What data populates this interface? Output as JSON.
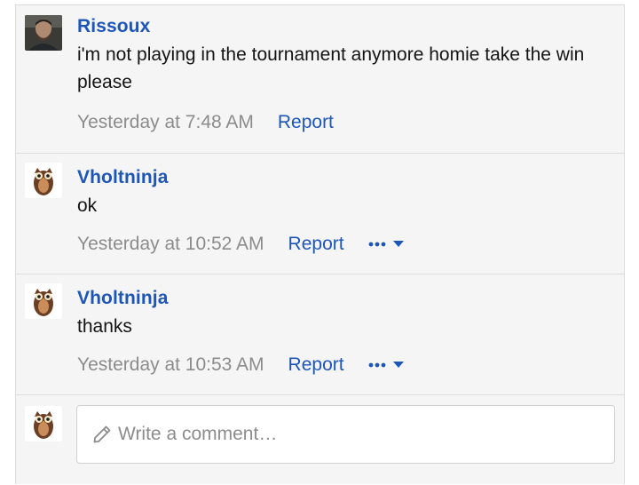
{
  "comments": [
    {
      "author": "Rissoux",
      "avatar": "man-photo-avatar",
      "text": "i'm not playing in the tournament anymore homie take the win please",
      "time": "Yesterday at 7:48 AM",
      "report_label": "Report",
      "has_more": false
    },
    {
      "author": "Vholtninja",
      "avatar": "owl-avatar",
      "text": "ok",
      "time": "Yesterday at 10:52 AM",
      "report_label": "Report",
      "has_more": true,
      "more_icon": "ellipsis-icon"
    },
    {
      "author": "Vholtninja",
      "avatar": "owl-avatar",
      "text": "thanks",
      "time": "Yesterday at 10:53 AM",
      "report_label": "Report",
      "has_more": true,
      "more_icon": "ellipsis-icon"
    }
  ],
  "composer": {
    "placeholder": "Write a comment…",
    "icon": "pencil-icon",
    "avatar": "owl-avatar"
  },
  "colors": {
    "link": "#1e56b8",
    "muted": "#8c8c8c",
    "background": "#f5f5f5",
    "border": "#dcdcdc"
  }
}
